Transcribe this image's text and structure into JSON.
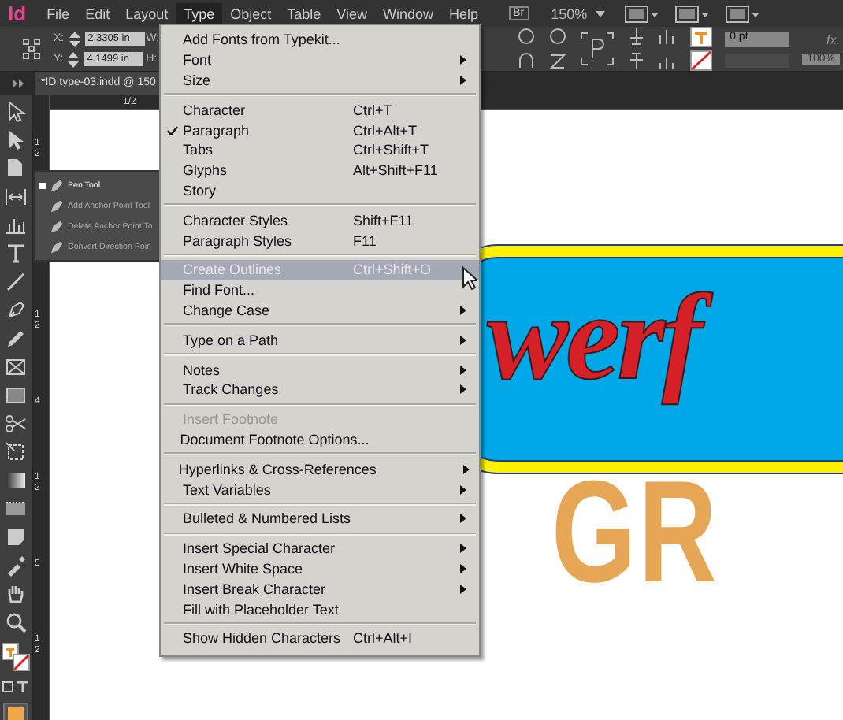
{
  "menubar": {
    "logo": "Id",
    "items": [
      {
        "label": "File",
        "selected": false
      },
      {
        "label": "Edit",
        "selected": false
      },
      {
        "label": "Layout",
        "selected": false
      },
      {
        "label": "Type",
        "selected": true
      },
      {
        "label": "Object",
        "selected": false
      },
      {
        "label": "Table",
        "selected": false
      },
      {
        "label": "View",
        "selected": false
      },
      {
        "label": "Window",
        "selected": false
      },
      {
        "label": "Help",
        "selected": false
      }
    ],
    "bridge": "Br",
    "zoom": "150%"
  },
  "control_panel": {
    "fields": [
      {
        "label": "X:",
        "value": "2.3305 in"
      },
      {
        "label": "Y:",
        "value": "4.1499 in"
      }
    ],
    "labels_cut": [
      "W:",
      "H:"
    ],
    "stroke_weight": "0 pt",
    "opacity": "100%",
    "effects": "fx."
  },
  "document_tab": {
    "title": "*ID type-03.indd @ 150"
  },
  "ruler": {
    "top_label": "1/2",
    "side_labels": [
      {
        "lines": [
          "1",
          "2"
        ]
      },
      {
        "lines": [
          "1",
          "2"
        ]
      },
      {
        "lines": [
          "4"
        ]
      },
      {
        "lines": [
          "1",
          "2"
        ]
      },
      {
        "lines": [
          "5"
        ]
      },
      {
        "lines": [
          "1",
          "2"
        ]
      }
    ]
  },
  "tool_flyout": {
    "items": [
      {
        "label": "Pen Tool",
        "selected": true
      },
      {
        "label": "Add Anchor Point Tool",
        "selected": false
      },
      {
        "label": "Delete Anchor Point To",
        "selected": false
      },
      {
        "label": "Convert Direction Poin",
        "selected": false
      }
    ]
  },
  "type_menu": {
    "sections": [
      [
        {
          "label": "Add Fonts from Typekit...",
          "submenu": false
        },
        {
          "label": "Font",
          "submenu": true
        },
        {
          "label": "Size",
          "submenu": true
        }
      ],
      [
        {
          "label": "Character",
          "shortcut": "Ctrl+T"
        },
        {
          "label": "Paragraph",
          "shortcut": "Ctrl+Alt+T",
          "checked": true
        },
        {
          "label": "Tabs",
          "shortcut": "Ctrl+Shift+T"
        },
        {
          "label": "Glyphs",
          "shortcut": "Alt+Shift+F11"
        },
        {
          "label": "Story"
        }
      ],
      [
        {
          "label": "Character Styles",
          "shortcut": "Shift+F11"
        },
        {
          "label": "Paragraph Styles",
          "shortcut": "F11"
        }
      ],
      [
        {
          "label": "Create Outlines",
          "shortcut": "Ctrl+Shift+O",
          "selected": true
        },
        {
          "label": "Find Font..."
        },
        {
          "label": "Change Case",
          "submenu": true
        }
      ],
      [
        {
          "label": "Type on a Path",
          "submenu": true
        }
      ],
      [
        {
          "label": "Notes",
          "submenu": true
        },
        {
          "label": "Track Changes",
          "submenu": true
        }
      ],
      [
        {
          "label": "Insert Footnote",
          "disabled": true
        },
        {
          "label": "Document Footnote Options..."
        }
      ],
      [
        {
          "label": "Hyperlinks & Cross-References",
          "submenu": true
        },
        {
          "label": "Text Variables",
          "submenu": true
        }
      ],
      [
        {
          "label": "Bulleted & Numbered Lists",
          "submenu": true
        }
      ],
      [
        {
          "label": "Insert Special Character",
          "submenu": true
        },
        {
          "label": "Insert White Space",
          "submenu": true
        },
        {
          "label": "Insert Break Character",
          "submenu": true
        },
        {
          "label": "Fill with Placeholder Text"
        }
      ],
      [
        {
          "label": "Show Hidden Characters",
          "shortcut": "Ctrl+Alt+I"
        }
      ]
    ]
  },
  "artwork": {
    "script_word": "werf",
    "block_word": "GR"
  }
}
